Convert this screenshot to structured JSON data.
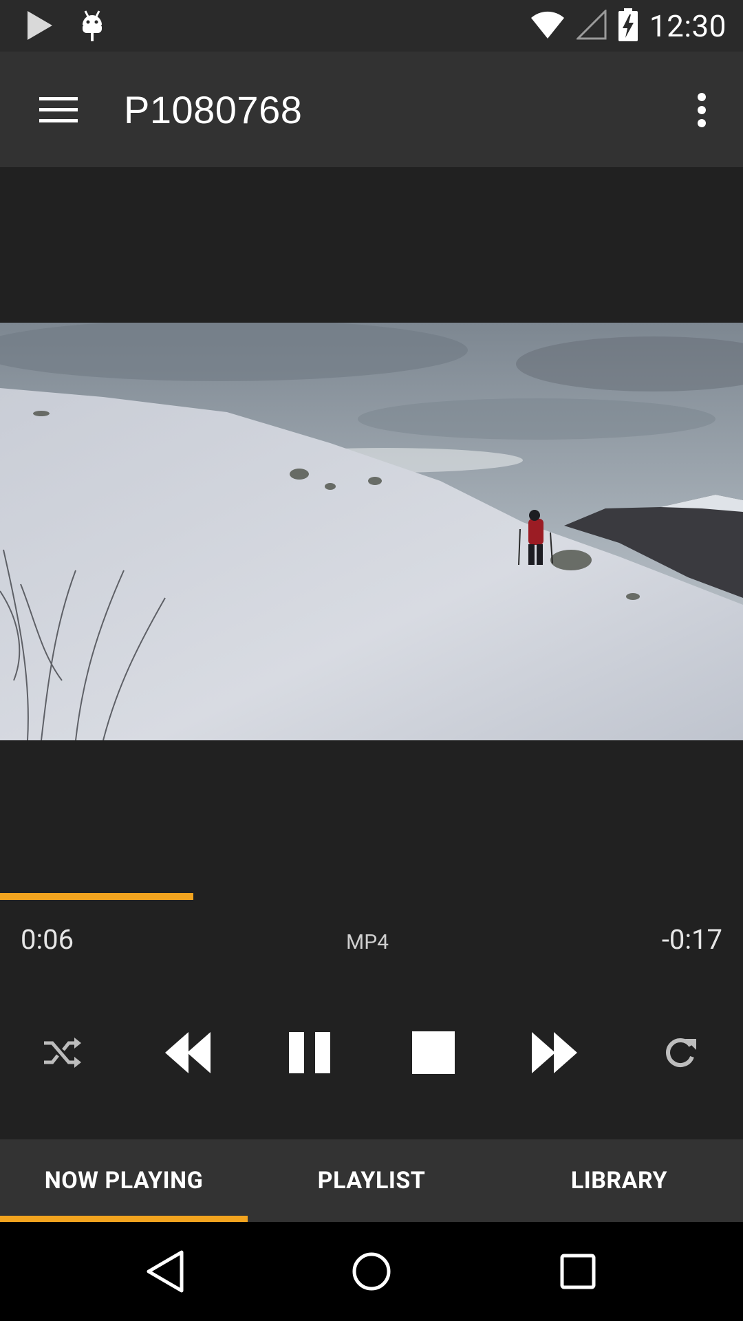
{
  "status_bar": {
    "time": "12:30",
    "icons": [
      "play-notification-icon",
      "android-debug-icon",
      "wifi-icon",
      "cell-signal-icon",
      "battery-charging-icon"
    ]
  },
  "app_bar": {
    "title": "P1080768",
    "menu_icon": "hamburger-menu-icon",
    "overflow_icon": "more-vert-icon"
  },
  "player": {
    "elapsed": "0:06",
    "format": "MP4",
    "remaining": "-0:17",
    "progress_fraction": 0.26,
    "accent_color": "#f2a41f"
  },
  "controls": [
    "shuffle-icon",
    "rewind-icon",
    "pause-icon",
    "stop-icon",
    "fast-forward-icon",
    "repeat-icon"
  ],
  "tabs": [
    {
      "label": "NOW PLAYING",
      "selected": true
    },
    {
      "label": "PLAYLIST",
      "selected": false
    },
    {
      "label": "LIBRARY",
      "selected": false
    }
  ],
  "nav_bar": [
    "back-icon",
    "home-icon",
    "recents-icon"
  ]
}
